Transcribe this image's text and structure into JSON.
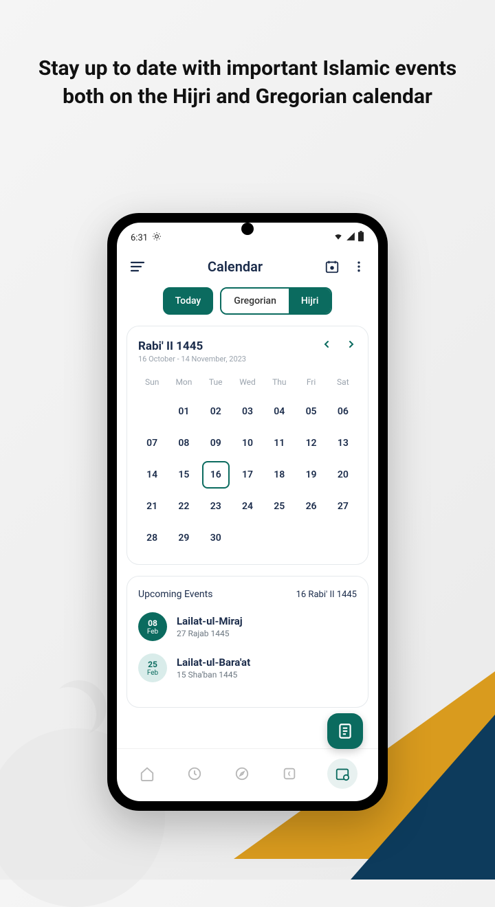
{
  "headline": "Stay up to date with important Islamic events both on the Hijri and Gregorian calendar",
  "status": {
    "time": "6:31",
    "wifi": true,
    "signal": true,
    "battery": true
  },
  "header": {
    "title": "Calendar"
  },
  "tabs": {
    "today": "Today",
    "gregorian": "Gregorian",
    "hijri": "Hijri"
  },
  "calendar": {
    "month": "Rabi' II 1445",
    "range": "16 October - 14 November, 2023",
    "dow": [
      "Sun",
      "Mon",
      "Tue",
      "Wed",
      "Thu",
      "Fri",
      "Sat"
    ],
    "leading_blanks": 1,
    "days": [
      "01",
      "02",
      "03",
      "04",
      "05",
      "06",
      "07",
      "08",
      "09",
      "10",
      "11",
      "12",
      "13",
      "14",
      "15",
      "16",
      "17",
      "18",
      "19",
      "20",
      "21",
      "22",
      "23",
      "24",
      "25",
      "26",
      "27",
      "28",
      "29",
      "30"
    ],
    "selected": "16"
  },
  "events": {
    "title": "Upcoming Events",
    "today": "16 Rabi' II 1445",
    "items": [
      {
        "day": "08",
        "mon": "Feb",
        "name": "Lailat-ul-Miraj",
        "sub": "27 Rajab 1445",
        "style": "dark"
      },
      {
        "day": "25",
        "mon": "Feb",
        "name": "Lailat-ul-Bara'at",
        "sub": "15 Sha'ban 1445",
        "style": "light"
      }
    ]
  }
}
